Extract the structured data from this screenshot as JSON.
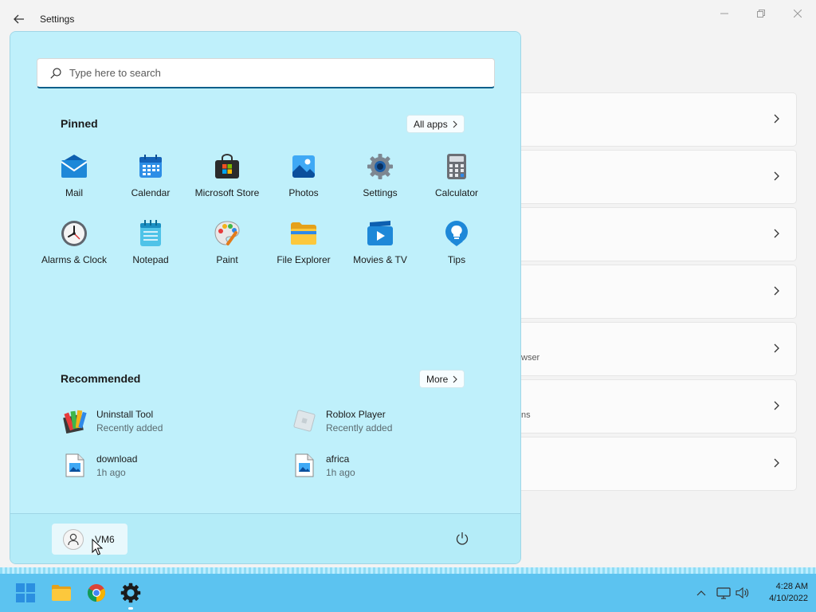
{
  "window": {
    "title": "Settings",
    "rows": [
      {
        "subtitle": ""
      },
      {
        "subtitle": ""
      },
      {
        "subtitle": ""
      },
      {
        "subtitle": ""
      },
      {
        "subtitle": "wser"
      },
      {
        "subtitle": "ns"
      },
      {
        "subtitle": ""
      }
    ]
  },
  "start": {
    "search_placeholder": "Type here to search",
    "pinned_title": "Pinned",
    "all_apps_label": "All apps",
    "pinned": [
      {
        "label": "Mail",
        "icon": "mail-icon"
      },
      {
        "label": "Calendar",
        "icon": "calendar-icon"
      },
      {
        "label": "Microsoft Store",
        "icon": "store-icon"
      },
      {
        "label": "Photos",
        "icon": "photos-icon"
      },
      {
        "label": "Settings",
        "icon": "gear-icon"
      },
      {
        "label": "Calculator",
        "icon": "calculator-icon"
      },
      {
        "label": "Alarms & Clock",
        "icon": "clock-icon"
      },
      {
        "label": "Notepad",
        "icon": "notepad-icon"
      },
      {
        "label": "Paint",
        "icon": "paint-icon"
      },
      {
        "label": "File Explorer",
        "icon": "folder-icon"
      },
      {
        "label": "Movies & TV",
        "icon": "movies-icon"
      },
      {
        "label": "Tips",
        "icon": "lightbulb-icon"
      }
    ],
    "recommended_title": "Recommended",
    "more_label": "More",
    "recommended": [
      {
        "name": "Uninstall Tool",
        "sub": "Recently added",
        "icon": "uninstall-tool-icon"
      },
      {
        "name": "Roblox Player",
        "sub": "Recently added",
        "icon": "roblox-icon"
      },
      {
        "name": "download",
        "sub": "1h ago",
        "icon": "image-file-icon"
      },
      {
        "name": "africa",
        "sub": "1h ago",
        "icon": "image-file-icon"
      }
    ],
    "user_name": "VM6"
  },
  "taskbar": {
    "apps": [
      "start-icon",
      "file-explorer-icon",
      "chrome-icon",
      "settings-icon"
    ],
    "time": "4:28 AM",
    "date": "4/10/2022"
  },
  "colors": {
    "start_bg": "#bff0fb",
    "taskbar_bg": "#5cc3f0",
    "accent": "#0a5f8a"
  }
}
